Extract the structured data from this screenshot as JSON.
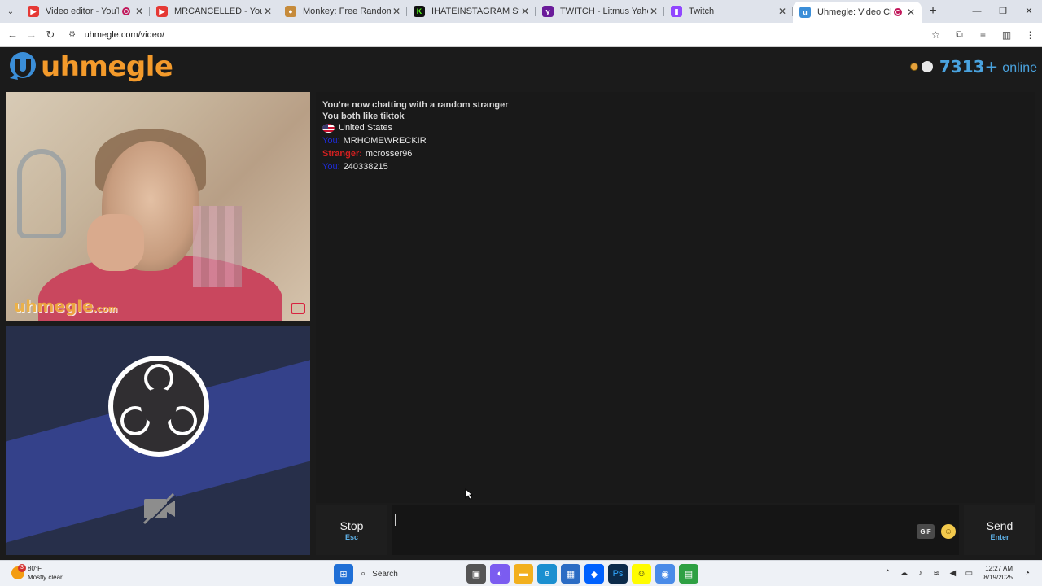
{
  "browser": {
    "tabs": [
      {
        "title": "Video editor - YouTube Stu",
        "recording": true,
        "active": false,
        "favicon_color": "#e53935"
      },
      {
        "title": "MRCANCELLED - YouTube",
        "recording": false,
        "active": false,
        "favicon_color": "#e53935"
      },
      {
        "title": "Monkey: Free Random Video C",
        "recording": false,
        "active": false,
        "favicon_color": "#c68b3b"
      },
      {
        "title": "IHATEINSTAGRAM Stream - Wa",
        "recording": false,
        "active": false,
        "favicon_color": "#2bb673"
      },
      {
        "title": "TWITCH - Litmus Yahoo Search",
        "recording": false,
        "active": false,
        "favicon_color": "#6a1b9a"
      },
      {
        "title": "Twitch",
        "recording": false,
        "active": false,
        "favicon_color": "#9146ff"
      },
      {
        "title": "Uhmegle: Video Chat | Ome",
        "recording": true,
        "active": true,
        "favicon_color": "#3b8ed8"
      }
    ],
    "new_tab_label": "+",
    "url": "uhmegle.com/video/"
  },
  "site": {
    "logo_text": "uhmegle",
    "online_count": "7313+",
    "online_label": "online",
    "watermark_main": "uhmegle",
    "watermark_tld": ".com"
  },
  "chat": {
    "status_line_1": "You're now chatting with a random stranger",
    "status_line_2": "You both like tiktok",
    "country": "United States",
    "messages": [
      {
        "sender": "You:",
        "text": "MRHOMEWRECKIR"
      },
      {
        "sender": "Stranger:",
        "text": "mcrosser96"
      },
      {
        "sender": "You:",
        "text": "240338215"
      }
    ]
  },
  "controls": {
    "stop_label": "Stop",
    "stop_key": "Esc",
    "gif_label": "GIF",
    "send_label": "Send",
    "send_key": "Enter",
    "message_value": ""
  },
  "taskbar": {
    "weather_temp": "80°F",
    "weather_desc": "Mostly clear",
    "weather_badge": "3",
    "search_placeholder": "Search",
    "time": "12:27 AM",
    "date": "8/19/2025"
  },
  "colors": {
    "brand_orange": "#f39a2b",
    "online_blue": "#4aa3df",
    "you_color": "#1e2bd8",
    "stranger_color": "#d32020"
  }
}
